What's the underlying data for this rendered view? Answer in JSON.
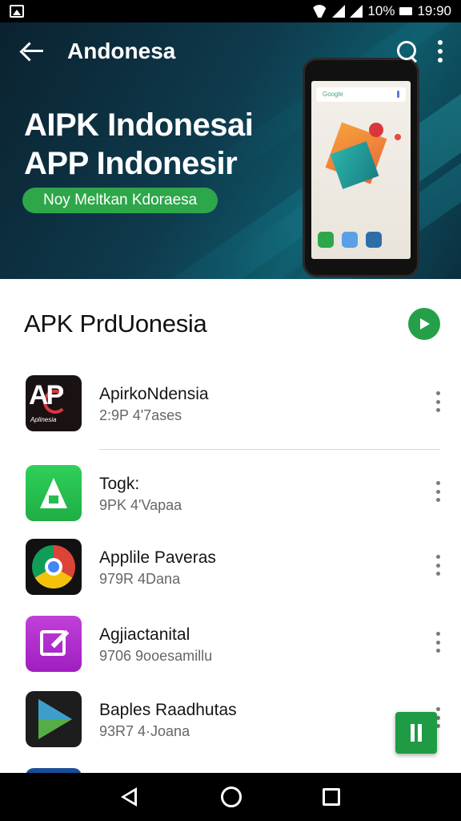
{
  "status_bar": {
    "battery_text": "10%",
    "time": "19:90"
  },
  "header": {
    "title": "Andonesa"
  },
  "hero": {
    "title_line1": "AIPK Indonesai",
    "title_line2": "APP Indonesir",
    "pill_label": "Noy Meltkan Kdoraesa",
    "phone_search_text": "Google"
  },
  "section": {
    "title": "APK PrdUonesia"
  },
  "apps": [
    {
      "name": "ApirkoNdensia",
      "meta": "2:9P 4'7ases"
    },
    {
      "name": "Togk:",
      "meta": "9PK 4'Vapaa"
    },
    {
      "name": "Applile Paveras",
      "meta": "979R 4Dana"
    },
    {
      "name": "Agjiactanital",
      "meta": "9706 9ooesamillu"
    },
    {
      "name": "Baples Raadhutas",
      "meta": "93R7 4·Joana"
    }
  ],
  "icons": {
    "app1": "apk-logo-icon",
    "app2": "green-a-icon",
    "app3": "chrome-icon",
    "app4": "edit-icon",
    "app5": "play-store-icon",
    "fab": "pause-icon"
  },
  "colors": {
    "accent_green": "#24a148",
    "hero_dark": "#0b2230",
    "hero_teal": "#0e5a6a"
  }
}
